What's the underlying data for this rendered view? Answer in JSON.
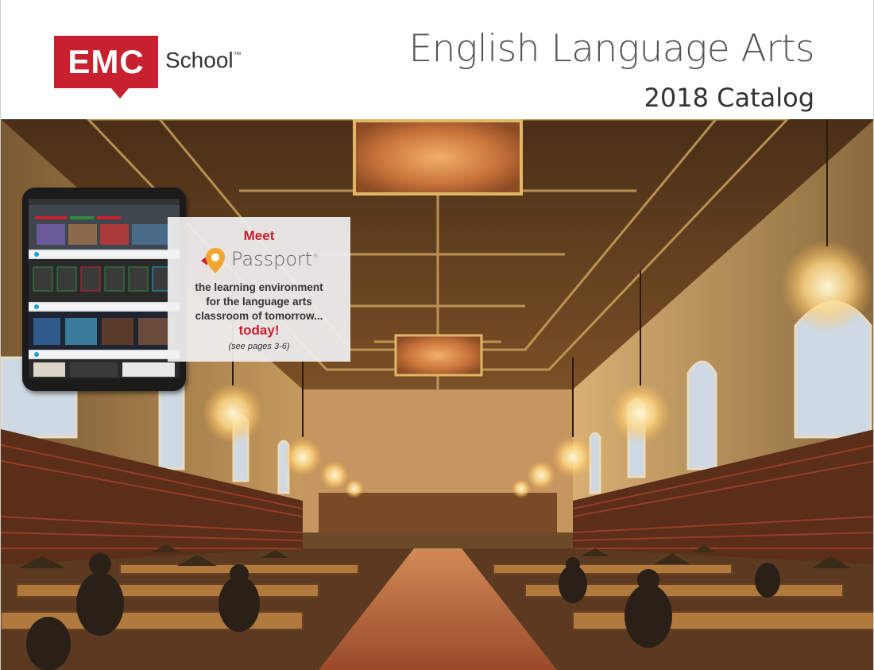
{
  "brand": {
    "logo_text": "EMC",
    "logo_suffix": "School",
    "trademark": "™",
    "color": "#c8202f"
  },
  "header": {
    "title": "English Language Arts",
    "subtitle": "2018 Catalog"
  },
  "callout": {
    "meet": "Meet",
    "product_name": "Passport",
    "product_mark": "®",
    "description_lines": [
      "the learning environment",
      "for the language arts",
      "classroom of tomorrow..."
    ],
    "emphasis": "today!",
    "reference": "(see pages 3-6)"
  },
  "photo": {
    "subject": "library reading room"
  }
}
